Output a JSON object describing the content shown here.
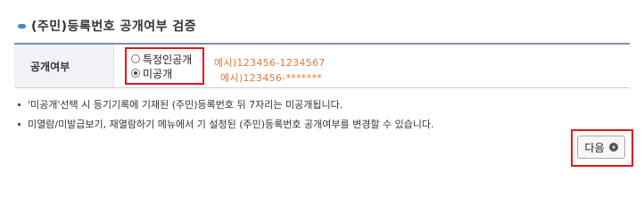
{
  "section": {
    "title": "(주민)등록번호 공개여부 검증"
  },
  "form": {
    "header_label": "공개여부",
    "options": [
      {
        "label": "특정인공개",
        "selected": false
      },
      {
        "label": "미공개",
        "selected": true
      }
    ],
    "examples": [
      "예시)123456-1234567",
      "예시)123456-*******"
    ]
  },
  "notes": [
    "'미공개'선택 시 등기기록에 기재된 (주민)등록번호 뒤 7자리는 미공개됩니다.",
    "미열람/미발급보기, 재열람하기 메뉴에서 기 설정된 (주민)등록번호 공개여부를 변경할 수 있습니다."
  ],
  "actions": {
    "next_label": "다음"
  },
  "colors": {
    "accent": "#4a86c5",
    "highlight": "#e8131a",
    "example_text": "#e0783c"
  }
}
